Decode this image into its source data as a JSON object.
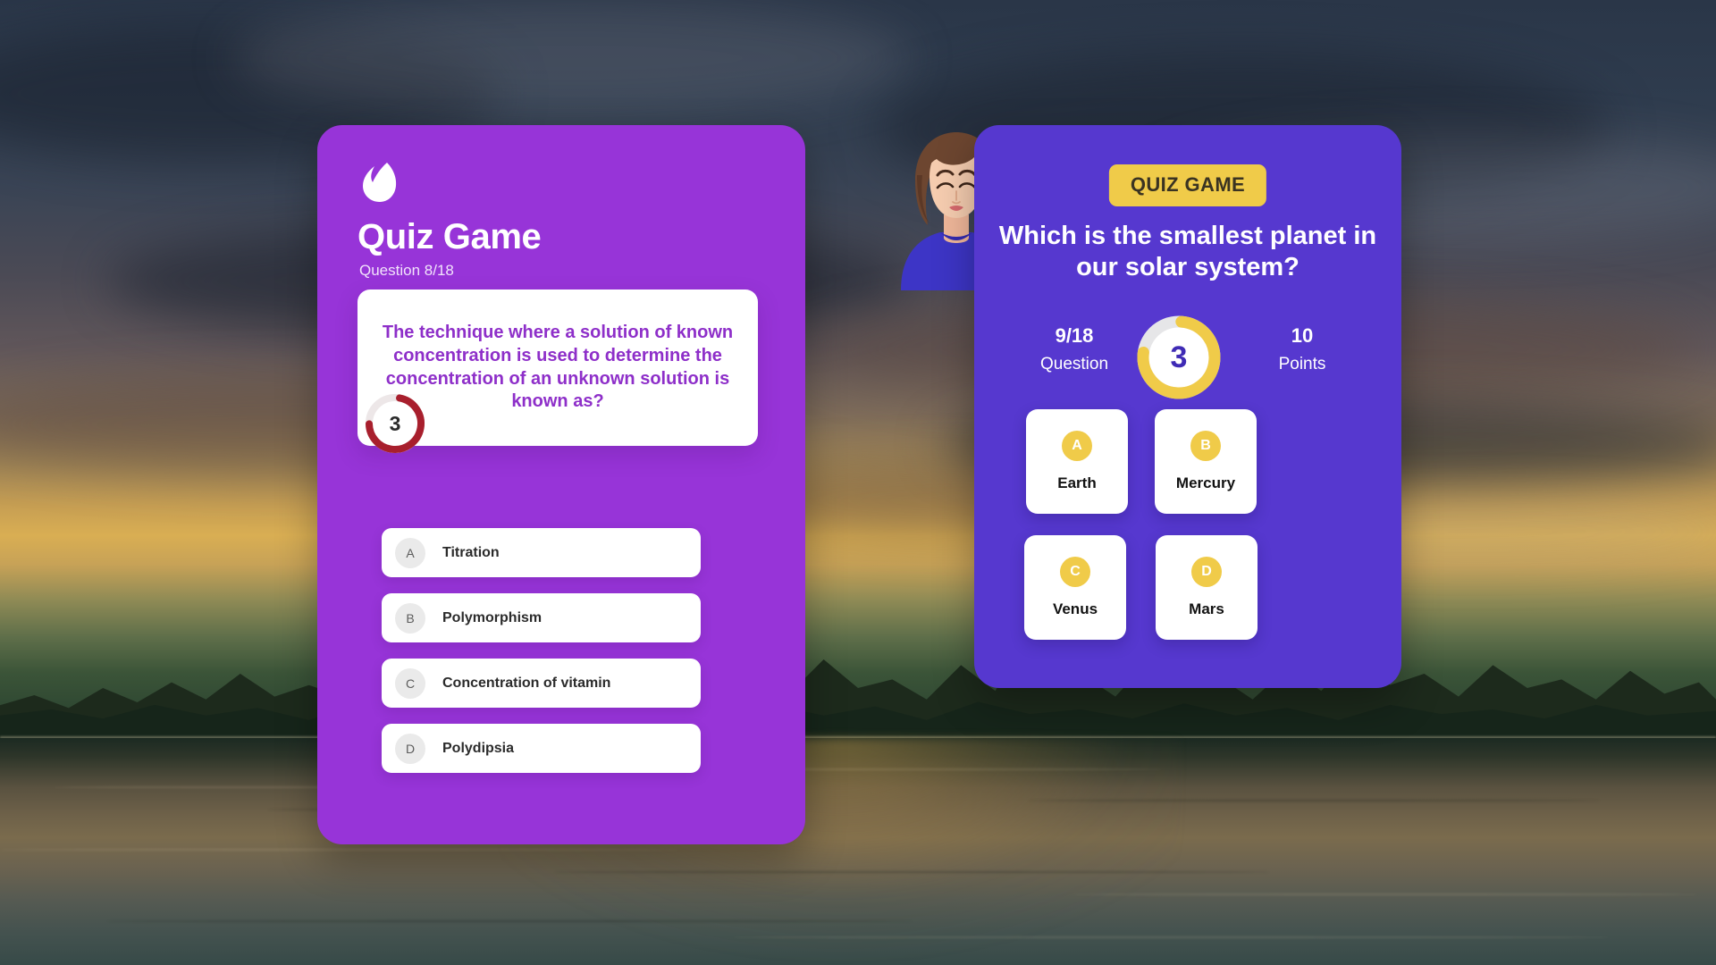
{
  "background": {
    "scene_description": "dusk lake with tree silhouettes and water reflection",
    "sky_color": "#2a3648",
    "sunset_color": "#d9ae53",
    "water_color": "#6e6149"
  },
  "left_panel": {
    "accent_color": "#9734d8",
    "logo_icon": "leaf-droplet-icon",
    "title": "Quiz Game",
    "subtitle": "Question 8/18",
    "avatar_icon": "female-avatar-illustration",
    "question_text": "The technique where a solution of known concentration is used to determine the concentration of an unknown solution is known as?",
    "question_text_color": "#8e2fc9",
    "timer": {
      "value": "3",
      "ring_color": "#a81f2d",
      "track_color": "#ede7e8",
      "progress_percent": 72
    },
    "answers": [
      {
        "badge": "A",
        "label": "Titration"
      },
      {
        "badge": "B",
        "label": "Polymorphism"
      },
      {
        "badge": "C",
        "label": "Concentration of vitamin"
      },
      {
        "badge": "D",
        "label": "Polydipsia"
      }
    ]
  },
  "right_panel": {
    "accent_color": "#5638cf",
    "badge_label": "QUIZ GAME",
    "badge_bg_color": "#f0cb49",
    "badge_text_color": "#3a3322",
    "question_text": "Which is the smallest planet in our solar system?",
    "stats": {
      "question_value": "9/18",
      "question_label": "Question",
      "points_value": "10",
      "points_label": "Points"
    },
    "timer": {
      "value": "3",
      "ring_color": "#f0cb49",
      "track_color": "#e6e6e8",
      "value_color": "#3f2bb5",
      "progress_percent": 76
    },
    "options": [
      {
        "badge": "A",
        "label": "Earth"
      },
      {
        "badge": "B",
        "label": "Mercury"
      },
      {
        "badge": "C",
        "label": "Venus"
      },
      {
        "badge": "D",
        "label": "Mars"
      }
    ]
  }
}
